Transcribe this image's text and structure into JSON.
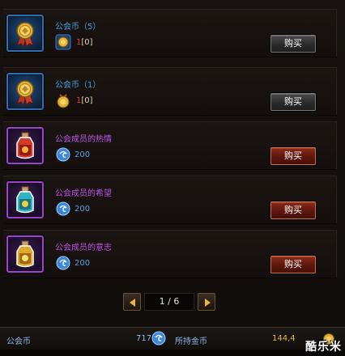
{
  "items": [
    {
      "name": "公会币（5）",
      "name_color": "blue",
      "price_type": "gold",
      "price_main": "1",
      "price_rest": "[0]",
      "buy_label": "购买",
      "buy_style": "gray",
      "icon": "gold-medal-icon"
    },
    {
      "name": "公会币（1）",
      "name_color": "blue",
      "price_type": "gold",
      "price_main": "1",
      "price_rest": "[0]",
      "buy_label": "购买",
      "buy_style": "gray",
      "icon": "gold-medal-icon"
    },
    {
      "name": "公会成员的热情",
      "name_color": "purple",
      "price_type": "guild",
      "price_main": "200",
      "price_rest": "",
      "buy_label": "购买",
      "buy_style": "red",
      "icon": "red-potion-bottle-icon"
    },
    {
      "name": "公会成员的希望",
      "name_color": "purple",
      "price_type": "guild",
      "price_main": "200",
      "price_rest": "",
      "buy_label": "购买",
      "buy_style": "red",
      "icon": "cyan-potion-bottle-icon"
    },
    {
      "name": "公会成员的意志",
      "name_color": "purple",
      "price_type": "guild",
      "price_main": "200",
      "price_rest": "",
      "buy_label": "购买",
      "buy_style": "red",
      "icon": "gold-potion-bottle-icon"
    }
  ],
  "pager": {
    "text": "1 / 6"
  },
  "footer": {
    "guild_coin_label": "公会币",
    "guild_coin_value": "717",
    "gold_label": "所持金币",
    "gold_value": "144,4"
  },
  "watermark": "酷乐米",
  "colors": {
    "blue_text": "#4d9be0",
    "purple_text": "#c055e8",
    "gold": "#e8b846",
    "red_button": "#5c160d"
  }
}
